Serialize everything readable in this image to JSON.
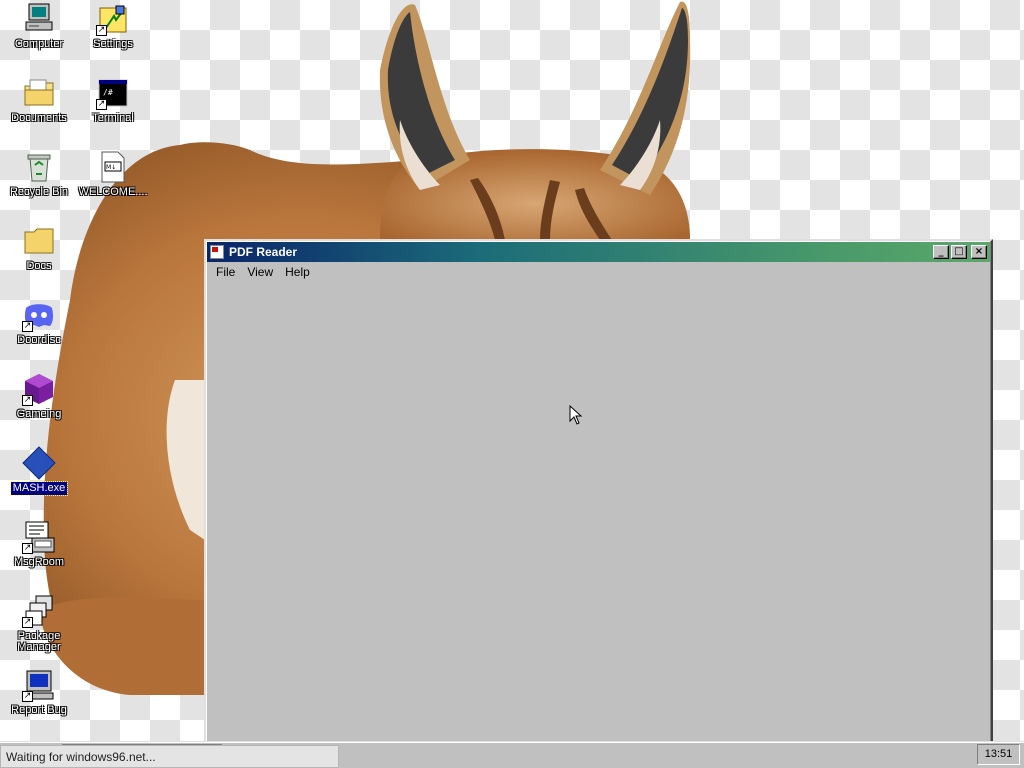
{
  "desktop": {
    "icons": [
      {
        "label": "Computer",
        "icon": "computer-icon"
      },
      {
        "label": "Settings",
        "icon": "settings-icon"
      },
      {
        "label": "Documents",
        "icon": "documents-folder-icon"
      },
      {
        "label": "Terminal",
        "icon": "terminal-icon"
      },
      {
        "label": "Recycle Bin",
        "icon": "recycle-bin-icon"
      },
      {
        "label": "WELCOME....",
        "icon": "markdown-file-icon"
      },
      {
        "label": "Docs",
        "icon": "folder-icon"
      },
      {
        "label": "Doordisc",
        "icon": "discord-icon"
      },
      {
        "label": "Gameing",
        "icon": "game-cube-icon"
      },
      {
        "label": "MASH.exe",
        "icon": "blue-diamond-icon"
      },
      {
        "label": "MsgRoom",
        "icon": "msgroom-icon"
      },
      {
        "label": "Package Manager",
        "icon": "package-manager-icon"
      },
      {
        "label": "Report Bug",
        "icon": "report-bug-icon"
      }
    ]
  },
  "window": {
    "title": "PDF Reader",
    "icon": "pdf-icon",
    "menu": [
      "File",
      "View",
      "Help"
    ],
    "buttons": {
      "minimize": "_",
      "maximize": "□",
      "close": "×"
    }
  },
  "status": {
    "text": "Waiting for windows96.net..."
  },
  "taskbar": {
    "clock": "13:51"
  },
  "colors": {
    "titlebar_start": "#0a246a",
    "titlebar_end": "#5aa86a",
    "selection": "#000080",
    "window_face": "#c0c0c0"
  }
}
